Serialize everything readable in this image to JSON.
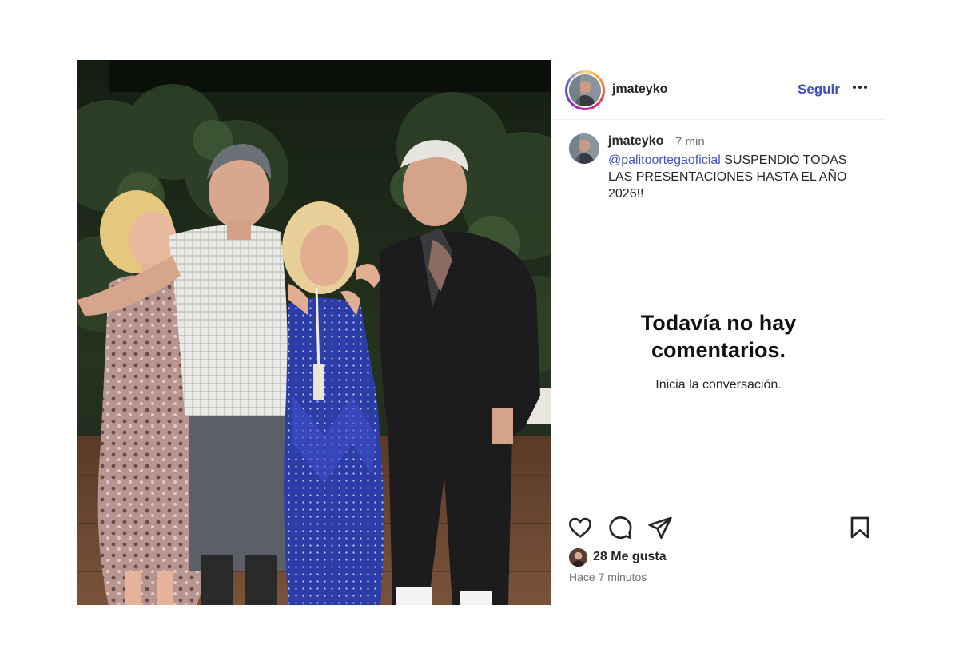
{
  "post": {
    "photo_alt": "",
    "header": {
      "username": "jmateyko",
      "follow_label": "Seguir",
      "more_icon": "more-horizontal-icon"
    },
    "caption": {
      "username": "jmateyko",
      "time": "7 min",
      "mention": "@palitoortegaoficial",
      "text": " SUSPENDIÓ TODAS LAS PRESENTACIONES HASTA EL AÑO 2026!!"
    },
    "comments_empty": {
      "title": "Todavía no hay comentarios.",
      "subtitle": "Inicia la conversación."
    },
    "actions": {
      "icons": [
        "heart-icon",
        "comment-icon",
        "share-icon",
        "bookmark-icon"
      ]
    },
    "likes_label": "28 Me gusta",
    "posted_ago": "Hace 7 minutos"
  },
  "colors": {
    "link_blue": "#3f4fc3",
    "text": "#262626",
    "muted": "#737373",
    "divider": "#efefef"
  }
}
